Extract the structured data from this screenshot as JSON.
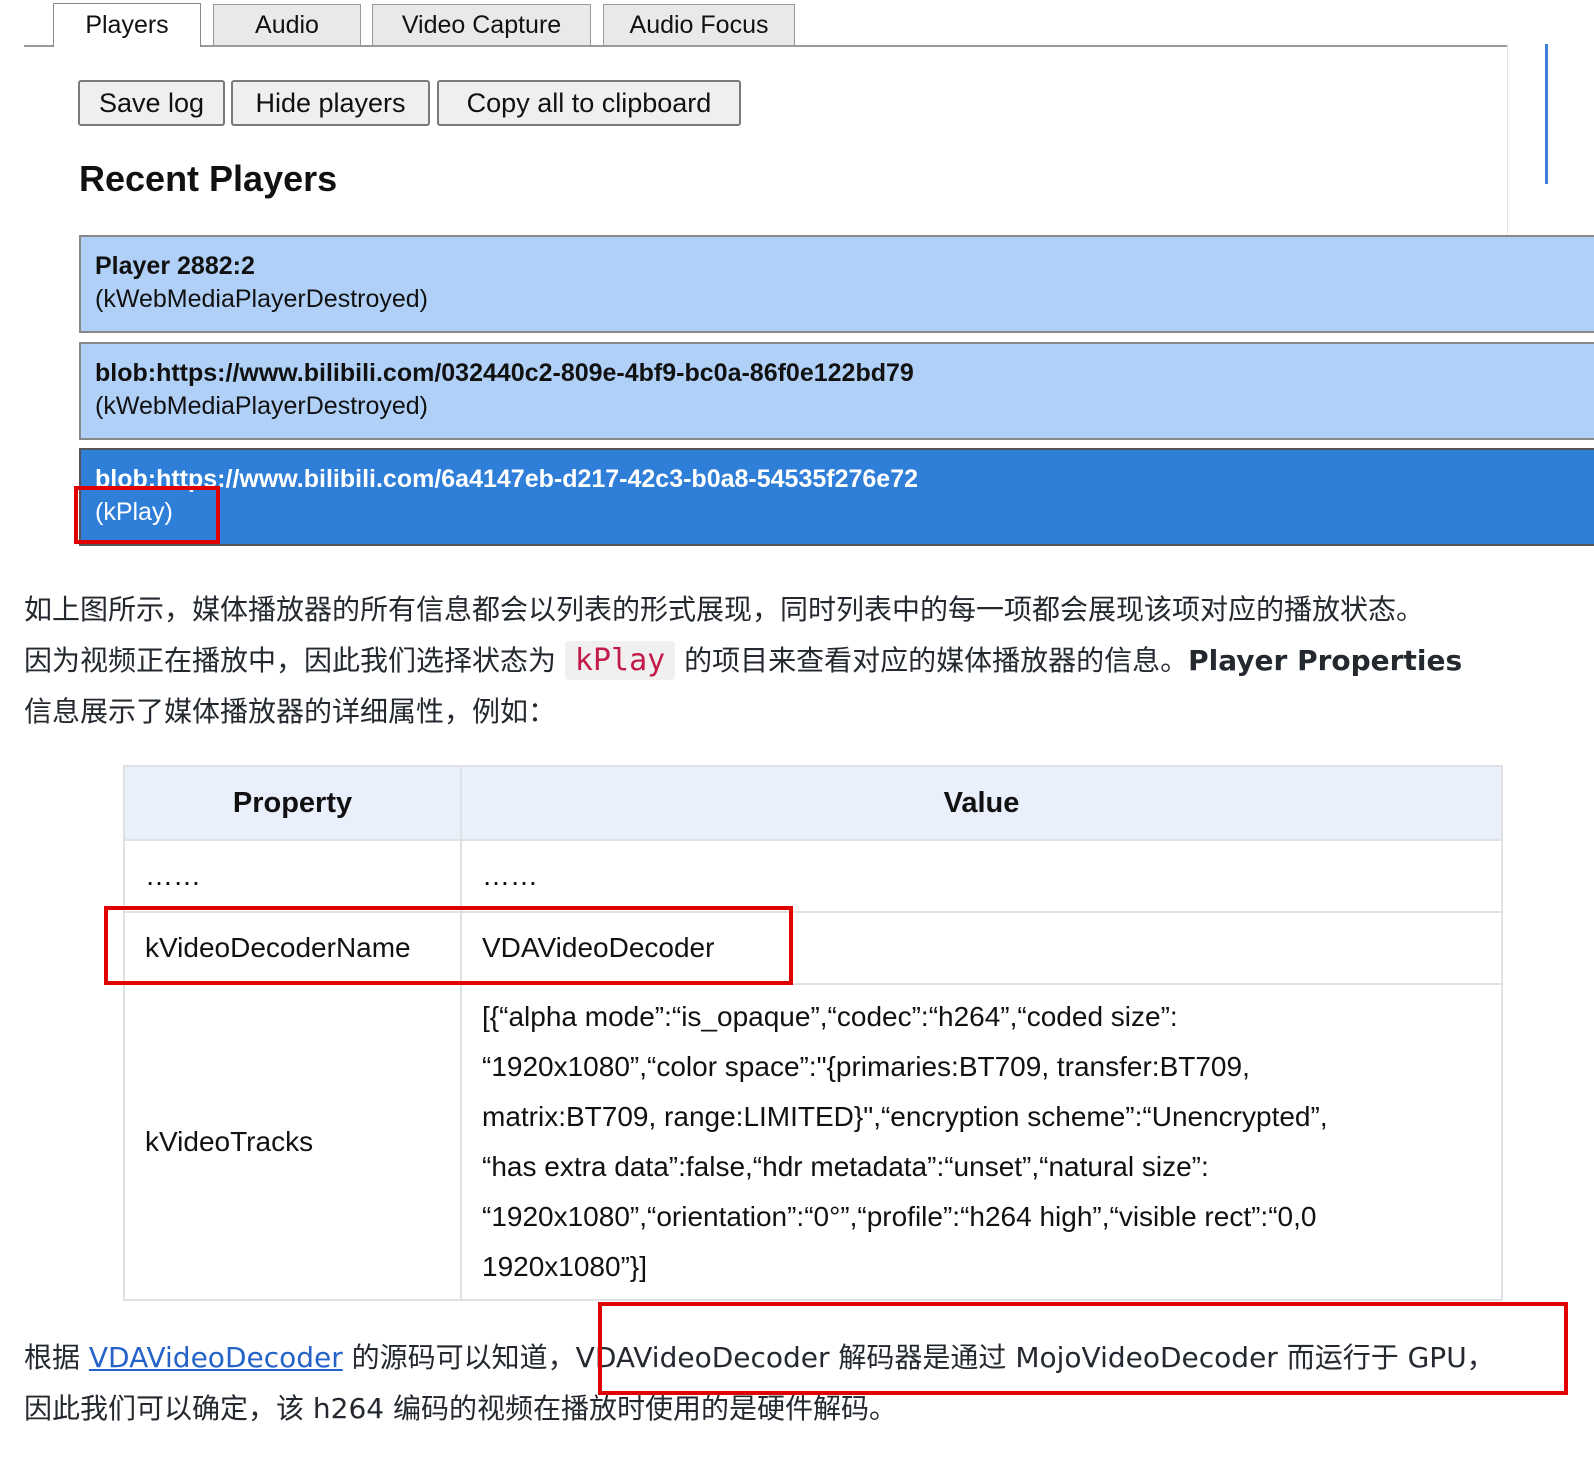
{
  "tabs": [
    "Players",
    "Audio",
    "Video Capture",
    "Audio Focus"
  ],
  "toolbar": {
    "save_log": "Save log",
    "hide_players": "Hide players",
    "copy_all": "Copy all to clipboard"
  },
  "recent_players": {
    "heading": "Recent Players",
    "items": [
      {
        "title": "Player 2882:2",
        "state": "(kWebMediaPlayerDestroyed)"
      },
      {
        "title": "blob:https://www.bilibili.com/032440c2-809e-4bf9-bc0a-86f0e122bd79",
        "state": "(kWebMediaPlayerDestroyed)"
      },
      {
        "title": "blob:https://www.bilibili.com/6a4147eb-d217-42c3-b0a8-54535f276e72",
        "state": "(kPlay)"
      }
    ]
  },
  "article": {
    "p1_line1": "如上图所示，媒体播放器的所有信息都会以列表的形式展现，同时列表中的每一项都会展现该项对应的播放状态。",
    "p1_line2_a": "因为视频正在播放中，因此我们选择状态为 ",
    "p1_code": "kPlay",
    "p1_line2_b": " 的项目来查看对应的媒体播放器的信息。",
    "p1_bold": "Player Properties",
    "p1_line3": "信息展示了媒体播放器的详细属性，例如：",
    "p2_line1_a": "根据 ",
    "p2_link": "VDAVideoDecoder",
    "p2_line1_b": " 的源码可以知道，",
    "p2_line1_c": "VDAVideoDecoder 解码器是通过 MojoVideoDecoder 而运行于 GPU，",
    "p2_line2": "因此我们可以确定，该 h264 编码的视频在播放时使用的是硬件解码。"
  },
  "table": {
    "headers": [
      "Property",
      "Value"
    ],
    "rows": [
      {
        "property": "……",
        "value": "……"
      },
      {
        "property": "kVideoDecoderName",
        "value": "VDAVideoDecoder"
      },
      {
        "property": "kVideoTracks",
        "value_lines": [
          "[{“alpha mode”:“is_opaque”,“codec”:“h264”,“coded size”:",
          "“1920x1080”,“color space”:\"{primaries:BT709, transfer:BT709,",
          "matrix:BT709, range:LIMITED}\",“encryption scheme”:“Unencrypted”,",
          "“has extra data”:false,“hdr metadata”:“unset”,“natural size”:",
          "“1920x1080”,“orientation”:“0°”,“profile”:“h264 high”,“visible rect”:“0,0",
          "1920x1080”}]"
        ]
      }
    ]
  }
}
